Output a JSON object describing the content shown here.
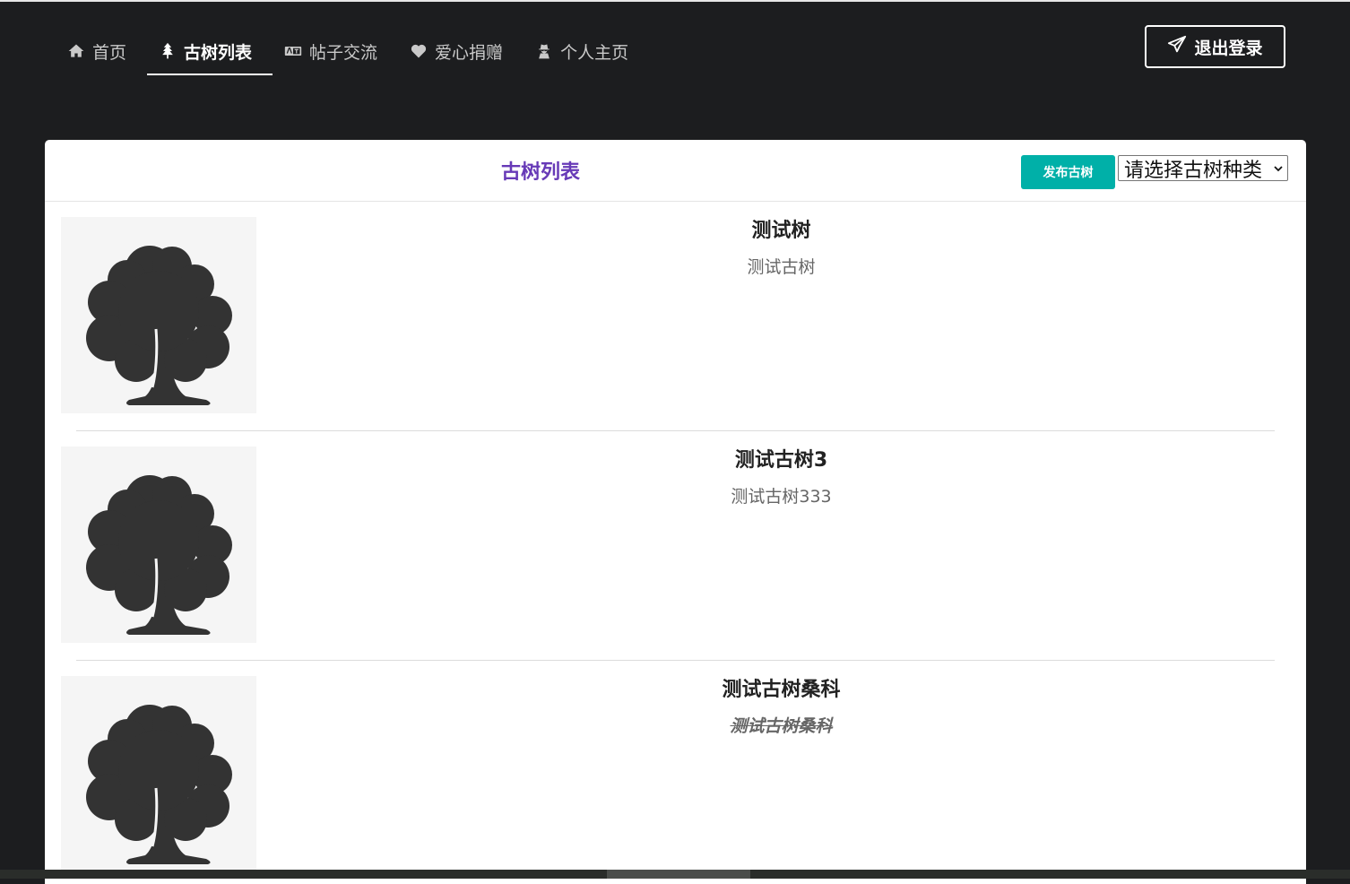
{
  "nav": {
    "items": [
      {
        "label": "首页",
        "icon": "home-icon",
        "active": false
      },
      {
        "label": "古树列表",
        "icon": "tree-icon",
        "active": true
      },
      {
        "label": "帖子交流",
        "icon": "language-icon",
        "active": false
      },
      {
        "label": "爱心捐赠",
        "icon": "heart-icon",
        "active": false
      },
      {
        "label": "个人主页",
        "icon": "user-secret-icon",
        "active": false
      }
    ],
    "logout_label": "退出登录",
    "logout_icon": "paper-plane-icon"
  },
  "panel": {
    "title": "古树列表",
    "publish_label": "发布古树",
    "select_value": "请选择古树种类"
  },
  "trees": [
    {
      "name": "测试树",
      "desc": "测试古树"
    },
    {
      "name": "测试古树3",
      "desc": "测试古树333"
    },
    {
      "name": "测试古树桑科",
      "desc": "测试古树桑科"
    }
  ],
  "colors": {
    "title_purple": "#673ab7",
    "publish_teal": "#00b0a8",
    "background_dark": "#1c1d1f"
  }
}
